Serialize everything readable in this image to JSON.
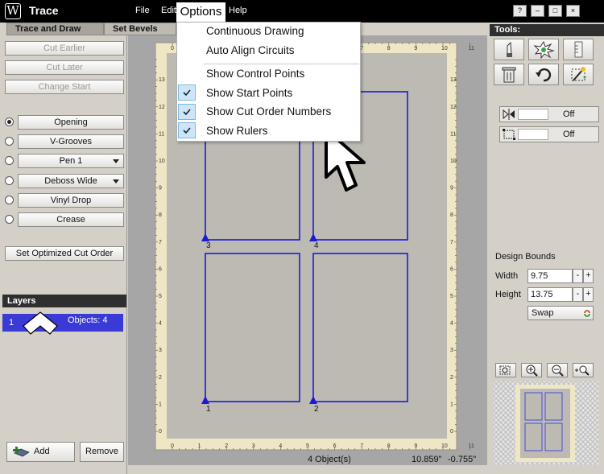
{
  "app": {
    "title": "Trace",
    "logo_glyph": "W"
  },
  "menubar": {
    "file": "File",
    "edit": "Edit",
    "options": "Options",
    "help": "Help"
  },
  "window_controls": [
    "?",
    "–",
    "□",
    "×"
  ],
  "tabs": {
    "trace_and_draw": "Trace and Draw",
    "set_bevels": "Set Bevels"
  },
  "left_panel": {
    "cut_earlier": "Cut Earlier",
    "cut_later": "Cut Later",
    "change_start": "Change Start",
    "tool_options": [
      {
        "label": "Opening",
        "selected": true,
        "dropdown": false
      },
      {
        "label": "V-Grooves",
        "selected": false,
        "dropdown": false
      },
      {
        "label": "Pen 1",
        "selected": false,
        "dropdown": true
      },
      {
        "label": "Deboss Wide",
        "selected": false,
        "dropdown": true
      },
      {
        "label": "Vinyl Drop",
        "selected": false,
        "dropdown": false
      },
      {
        "label": "Crease",
        "selected": false,
        "dropdown": false
      }
    ],
    "set_optimized": "Set Optimized Cut Order",
    "layers_title": "Layers",
    "layer": {
      "index": "1",
      "objects": "Objects: 4"
    },
    "add_label": "Add",
    "remove_label": "Remove"
  },
  "options_menu": {
    "items": [
      {
        "label": "Continuous Drawing",
        "checked": false
      },
      {
        "label": "Auto Align Circuits",
        "checked": false
      },
      {
        "label": "Show Control Points",
        "checked": false
      },
      {
        "label": "Show Start Points",
        "checked": true
      },
      {
        "label": "Show Cut Order Numbers",
        "checked": true
      },
      {
        "label": "Show Rulers",
        "checked": true
      }
    ]
  },
  "canvas": {
    "order_numbers": [
      "1",
      "2",
      "3",
      "4"
    ],
    "ruler_top": [
      "0",
      "1",
      "2",
      "3",
      "4",
      "5",
      "6",
      "7",
      "8",
      "9",
      "10",
      "11"
    ],
    "ruler_side": [
      "0",
      "1",
      "2",
      "3",
      "4",
      "5",
      "6",
      "7",
      "8",
      "9",
      "10",
      "11",
      "12",
      "13"
    ],
    "shape_color": "#1a1ad8",
    "mat_color": "#bdbab3",
    "ruler_color": "#efe6c6"
  },
  "status": {
    "objects": "4 Object(s)",
    "x": "10.859\"",
    "y": "-0.755\""
  },
  "right_panel": {
    "tools_title": "Tools:",
    "toggle1": "Off",
    "toggle2": "Off",
    "design_bounds_title": "Design Bounds",
    "width_label": "Width",
    "width_value": "9.75",
    "height_label": "Height",
    "height_value": "13.75",
    "swap_label": "Swap",
    "minus": "-",
    "plus": "+"
  },
  "icons": [
    "knife-icon",
    "burst-icon",
    "ruler-icon",
    "trash-icon",
    "undo-icon",
    "magic-wand-icon",
    "mirror-icon",
    "scale-icon",
    "zoom-fit-icon",
    "zoom-in-icon",
    "zoom-out-icon",
    "zoom-select-icon",
    "swap-arrows-icon",
    "cursor-arrow-icon",
    "chevron-up-icon",
    "add-layer-icon"
  ]
}
